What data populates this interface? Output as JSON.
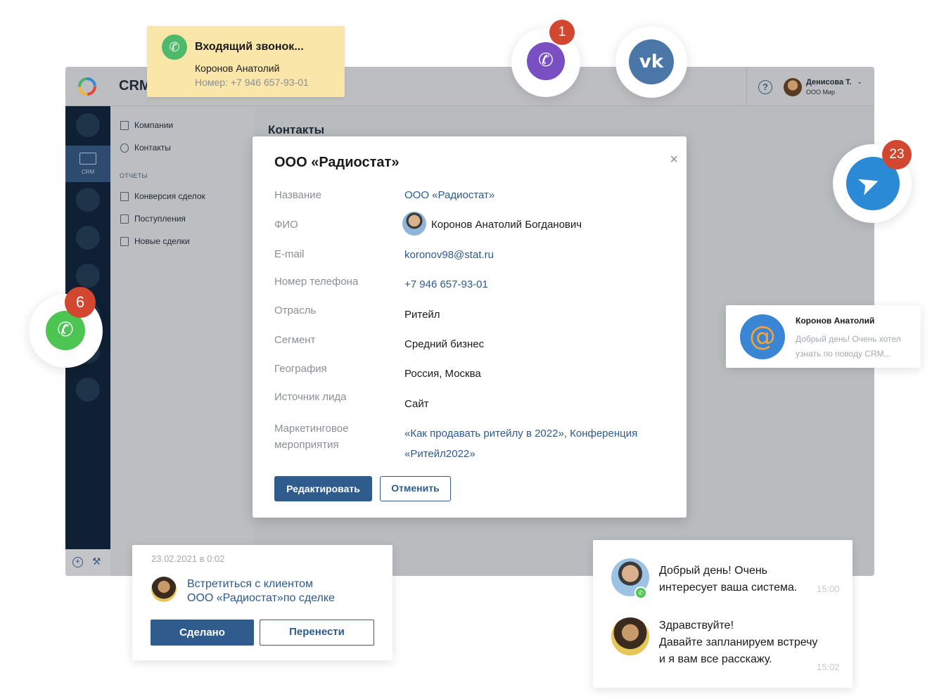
{
  "app": {
    "brand": "CRM",
    "content_title": "Контакты",
    "user": {
      "name": "Денисова Т.",
      "org": "ООО Мир"
    },
    "help_glyph": "?",
    "rail": {
      "crm_label": "CRM"
    }
  },
  "sidenav": {
    "items": [
      {
        "label": "Компании"
      },
      {
        "label": "Контакты"
      }
    ],
    "section_title": "ОТЧЕТЫ",
    "reports": [
      {
        "label": "Конверсия сделок"
      },
      {
        "label": "Поступления"
      },
      {
        "label": "Новые сделки"
      }
    ]
  },
  "modal": {
    "title": "ООО «Радиостат»",
    "close_glyph": "×",
    "rows": [
      {
        "label": "Название",
        "value": "ООО «Радиостат»"
      },
      {
        "label": "ФИО",
        "value": "Коронов Анатолий Богданович"
      },
      {
        "label": "E-mail",
        "value": "koronov98@stat.ru"
      },
      {
        "label": "Номер телефона",
        "value": "+7 946 657-93-01"
      },
      {
        "label": "Отрасль",
        "value": "Ритейл"
      },
      {
        "label": "Сегмент",
        "value": "Средний бизнес"
      },
      {
        "label": "География",
        "value": "Россия, Москва"
      },
      {
        "label": "Источник лида",
        "value": "Сайт"
      },
      {
        "label_line1": "Маркетинговое",
        "label_line2": "мероприятия",
        "value_line1": "«Как продавать ритейлу в 2022», Конференция",
        "value_line2": "«Ритейл2022»"
      }
    ],
    "edit_button": "Редактировать",
    "cancel_button": "Отменить"
  },
  "call": {
    "title": "Входящий звонок...",
    "name": "Коронов Анатолий",
    "phone": "Номер: +7 946 657-93-01"
  },
  "messengers": {
    "viber_badge": "1",
    "vk_glyph": "vk",
    "telegram_badge": "23",
    "whatsapp_badge": "6"
  },
  "mail": {
    "glyph": "@",
    "name": "Коронов Анатолий",
    "text": "Добрый день! Очень хотел узнать по поводу CRM..."
  },
  "task": {
    "date": "23.02.2021 в 0:02",
    "line1": "Встретиться с клиентом",
    "line2": "ООО «Радиостат»по сделке",
    "done_button": "Сделано",
    "move_button": "Перенести"
  },
  "chat": {
    "msg1_line1": "Добрый день! Очень",
    "msg1_line2": "интересует ваша система.",
    "time1": "15:00",
    "msg2_line1": "Здравствуйте!",
    "msg2_line2": "Давайте запланируем встречу",
    "msg2_line3": "и я вам все расскажу.",
    "time2": "15:02"
  },
  "colors": {
    "primary": "#2f5c8c",
    "rail": "#0f2034",
    "call_card": "#fbe6a9",
    "badge": "#d2472f"
  }
}
